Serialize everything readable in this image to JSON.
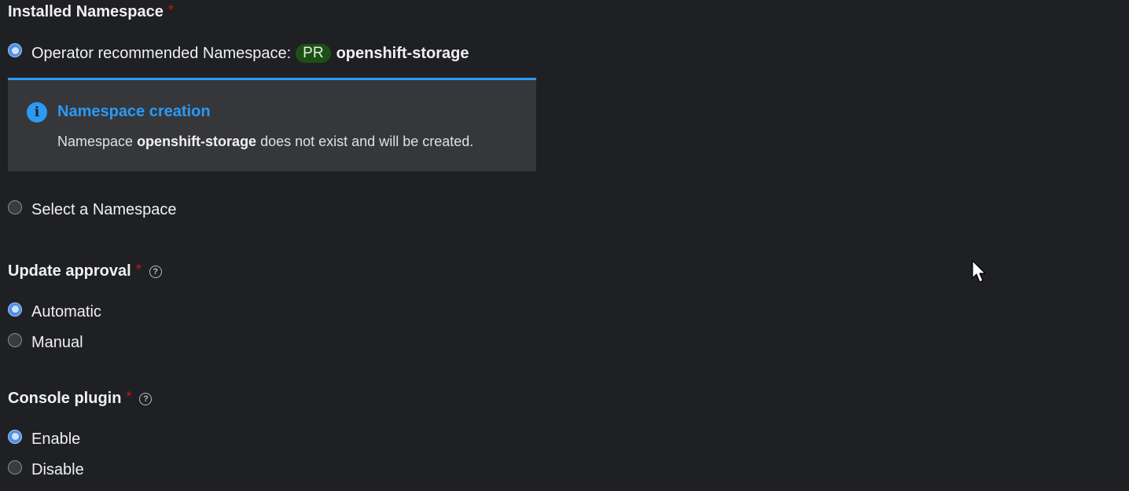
{
  "installed_namespace": {
    "label": "Installed Namespace",
    "required_mark": "*",
    "option_recommended": {
      "label": "Operator recommended Namespace:",
      "badge": "PR",
      "namespace": "openshift-storage",
      "selected": true
    },
    "alert": {
      "icon": "info-icon",
      "title": "Namespace creation",
      "body_prefix": "Namespace",
      "body_namespace": "openshift-storage",
      "body_suffix": "does not exist and will be created."
    },
    "option_select": {
      "label": "Select a Namespace",
      "selected": false
    }
  },
  "update_approval": {
    "label": "Update approval",
    "required_mark": "*",
    "help_icon": "?",
    "options": [
      {
        "label": "Automatic",
        "selected": true
      },
      {
        "label": "Manual",
        "selected": false
      }
    ]
  },
  "console_plugin": {
    "label": "Console plugin",
    "required_mark": "*",
    "help_icon": "?",
    "options": [
      {
        "label": "Enable",
        "selected": true
      },
      {
        "label": "Disable",
        "selected": false
      }
    ]
  },
  "colors": {
    "background": "#1f2024",
    "accent": "#2b9af3",
    "required": "#c9190b",
    "badge": "#1e4f18"
  }
}
